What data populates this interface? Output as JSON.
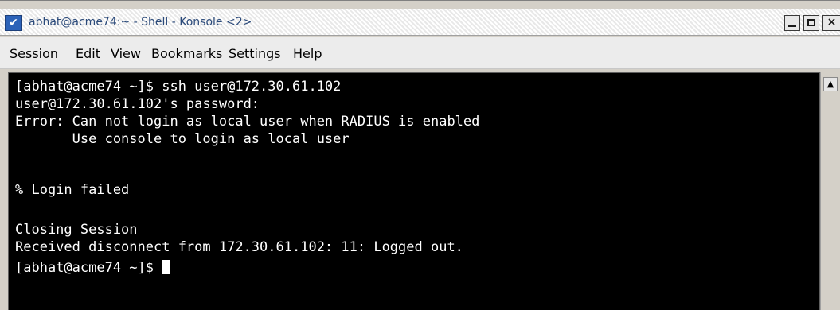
{
  "window": {
    "title": "abhat@acme74:~ - Shell - Konsole <2>",
    "menu_icon": "chevron-down-icon",
    "buttons": {
      "minimize": "minimize-icon",
      "maximize": "maximize-icon",
      "close": "×"
    }
  },
  "menubar": {
    "items": [
      "Session",
      "Edit",
      "View",
      "Bookmarks",
      "Settings",
      "Help"
    ]
  },
  "terminal": {
    "background": "#000000",
    "foreground": "#ffffff",
    "lines": [
      "[abhat@acme74 ~]$ ssh user@172.30.61.102",
      "user@172.30.61.102's password:",
      "Error: Can not login as local user when RADIUS is enabled",
      "       Use console to login as local user",
      "",
      "% Login failed",
      "",
      "Closing Session",
      "Received disconnect from 172.30.61.102: 11: Logged out.",
      "[abhat@acme74 ~]$ "
    ]
  },
  "scrollbar": {
    "up_arrow": "▲"
  }
}
